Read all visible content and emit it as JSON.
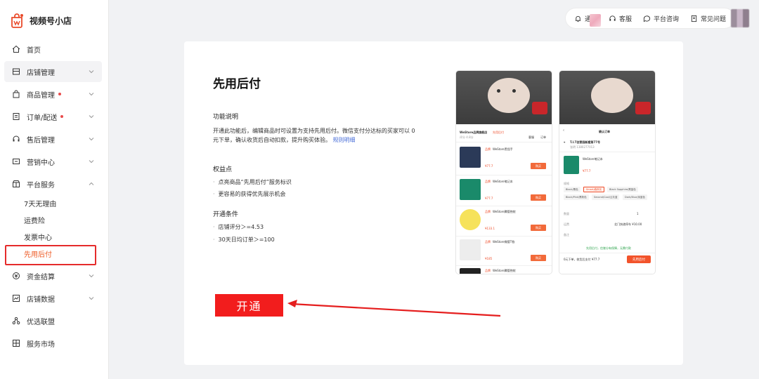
{
  "app": {
    "name": "视频号小店"
  },
  "sidebar": {
    "items": [
      {
        "label": "首页",
        "icon": "home-icon"
      },
      {
        "label": "店铺管理",
        "icon": "store-icon"
      },
      {
        "label": "商品管理",
        "icon": "bag-icon"
      },
      {
        "label": "订单/配送",
        "icon": "order-icon"
      },
      {
        "label": "售后管理",
        "icon": "headset-icon"
      },
      {
        "label": "营销中心",
        "icon": "marketing-icon"
      },
      {
        "label": "平台服务",
        "icon": "service-icon"
      },
      {
        "label": "资金结算",
        "icon": "money-icon"
      },
      {
        "label": "店铺数据",
        "icon": "data-icon"
      },
      {
        "label": "优选联盟",
        "icon": "alliance-icon"
      },
      {
        "label": "服务市场",
        "icon": "market-icon"
      }
    ],
    "sub_items": [
      {
        "label": "7天无理由"
      },
      {
        "label": "运费险"
      },
      {
        "label": "发票中心"
      },
      {
        "label": "先用后付"
      }
    ]
  },
  "topbar": {
    "notify": "通知",
    "service": "客服",
    "consult": "平台咨询",
    "faq": "常见问题"
  },
  "main": {
    "title": "先用后付",
    "feature_title": "功能说明",
    "feature_desc": "开通此功能后，编辑商品时可设置为支持先用后付。微信支付分达标的买家可以 0 元下单，确认收货后自动扣款，提升购买体验。",
    "rules_link": "规则明细",
    "benefits_title": "权益点",
    "benefits": [
      "点亮商品“先用后付”服务标识",
      "更容易的获得优先展示机会"
    ],
    "conditions_title": "开通条件",
    "conditions": [
      "店铺评分＞=4.53",
      "30天日均订单＞=100"
    ],
    "open_button": "开通"
  },
  "phone1": {
    "shop_name": "WeStore品牌旗舰店",
    "badge": "先用后付",
    "rating": "评分 4.8分",
    "actions": [
      "客服",
      "订单"
    ],
    "products": [
      {
        "tag": "品牌",
        "name": "WeStore黑怪手",
        "price": "¥77.7",
        "buy": "购买"
      },
      {
        "tag": "品牌",
        "name": "WeStore笔记本",
        "price": "¥77.7",
        "buy": "购买"
      },
      {
        "tag": "品牌",
        "name": "WeStore腾管抱枕",
        "price": "¥133.1",
        "buy": "购买"
      },
      {
        "tag": "品牌",
        "name": "WeStore微管T恤",
        "price": "¥185",
        "buy": "购买"
      },
      {
        "tag": "品牌",
        "name": "WeStore腾管抱枕",
        "price": "",
        "buy": ""
      }
    ]
  },
  "phone2": {
    "header": "确认订单",
    "address": "T.I.T创意园新搬第77号",
    "phone": "张明 1380277013",
    "product_name": "WeStore笔记本",
    "price": "¥77.7",
    "spec_label": "规格",
    "chips": [
      "Black/黑色",
      "Smart/森系灰",
      "Black Sapphire/黑蓝色",
      "Black/Pink/黑粉色",
      "Second/Cool/云灰蓝",
      "Dark/Blue/深蓝色"
    ],
    "qty_label": "数量",
    "qty": "1",
    "ship_label": "运费",
    "ship_value": "北门快递停车 ¥10.00",
    "remark_label": "备注",
    "notice": "先用后付，信誉分有保障，无需付款",
    "total_text": "0元下单，收货后支付 ¥77.7",
    "pay_button": "先用后付"
  },
  "colors": {
    "accent": "#f21d1d",
    "link": "#4a6fd8",
    "highlight": "#e52b2b",
    "orange": "#ee5a24"
  }
}
